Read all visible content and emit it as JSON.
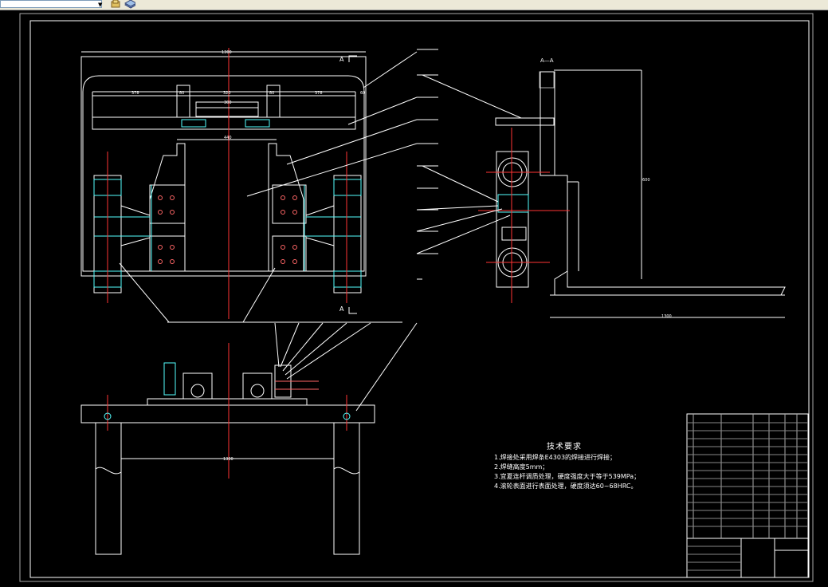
{
  "toolbar": {
    "combo_value": "",
    "icons": [
      "layer-state-icon",
      "layer-properties-icon"
    ]
  },
  "drawing": {
    "section_marker_top": "A",
    "section_marker_bottom": "A",
    "section_title": "A—A",
    "tech_title": "技术要求",
    "tech_lines": [
      "1.焊接处采用焊条E4303的焊接进行焊接；",
      "2.焊缝高度5mm；",
      "3.宜夏连杆调质处理，硬度强度大于等于539MPa；",
      "4.滚轮表面进行表面处理，硬度须达60~68HRC。"
    ],
    "dims_top": [
      "1300",
      "378",
      "80",
      "320",
      "80",
      "378",
      "60",
      "300",
      "440"
    ],
    "dim_bottom_width": "1300",
    "dim_side_height": "600",
    "dim_side_bottom": "1300"
  }
}
